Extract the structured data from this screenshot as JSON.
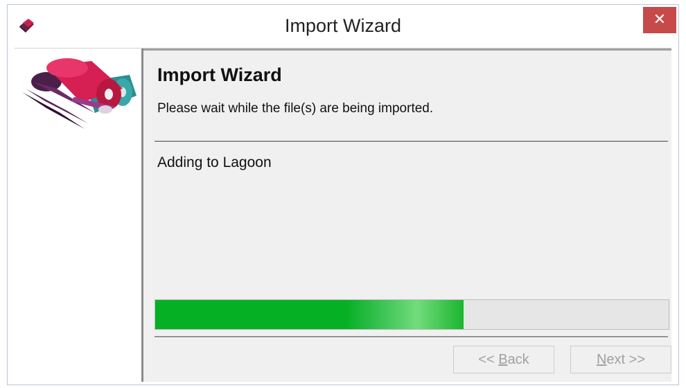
{
  "window": {
    "title": "Import Wizard",
    "close_label": "✕"
  },
  "header": {
    "title": "Import Wizard",
    "subtitle": "Please wait while the file(s) are being imported."
  },
  "status": {
    "text": "Adding to Lagoon"
  },
  "progress": {
    "fraction": 0.6
  },
  "buttons": {
    "back_prefix": "<< ",
    "back_accel": "B",
    "back_rest": "ack",
    "back_enabled": false,
    "next_accel": "N",
    "next_rest": "ext >>",
    "next_enabled": false
  },
  "icons": {
    "app": "app-icon",
    "side": "fabric-rolls-icon",
    "close": "close-icon"
  },
  "colors": {
    "close_bg": "#c74a4a",
    "progress_green": "#06b025"
  }
}
